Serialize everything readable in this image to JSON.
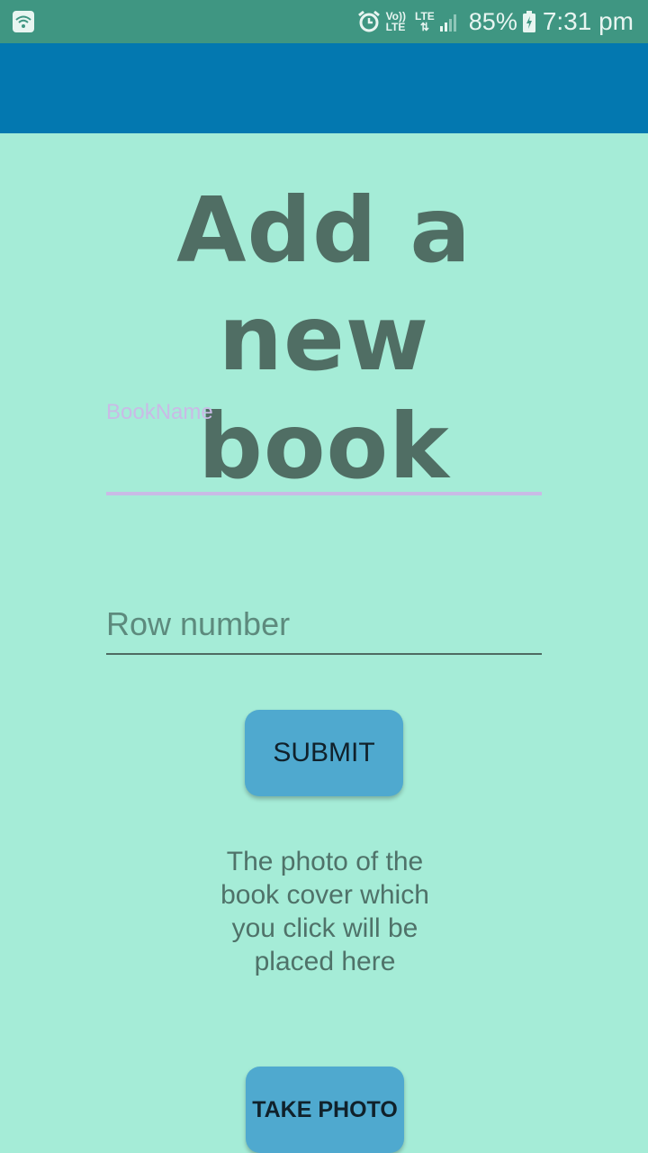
{
  "status_bar": {
    "volte_top": "Vo))",
    "volte_bottom": "LTE",
    "lte": "LTE",
    "battery_percent": "85%",
    "time": "7:31 pm",
    "icons": [
      "wifi-icon",
      "alarm-icon",
      "signal-icon",
      "battery-charging-icon"
    ]
  },
  "toolbar": {
    "color": "#0378b0"
  },
  "page": {
    "title": "Add a new book",
    "background": "#a5ecd7"
  },
  "form": {
    "book_name_label": "BookName",
    "book_name_value": "",
    "row_number_placeholder": "Row number",
    "row_number_value": "",
    "submit_label": "SUBMIT",
    "accent": "#4fa9cf"
  },
  "photo": {
    "placeholder_text": "The photo of the book cover which you click will be placed here",
    "take_photo_label": "TAKE PHOTO"
  }
}
